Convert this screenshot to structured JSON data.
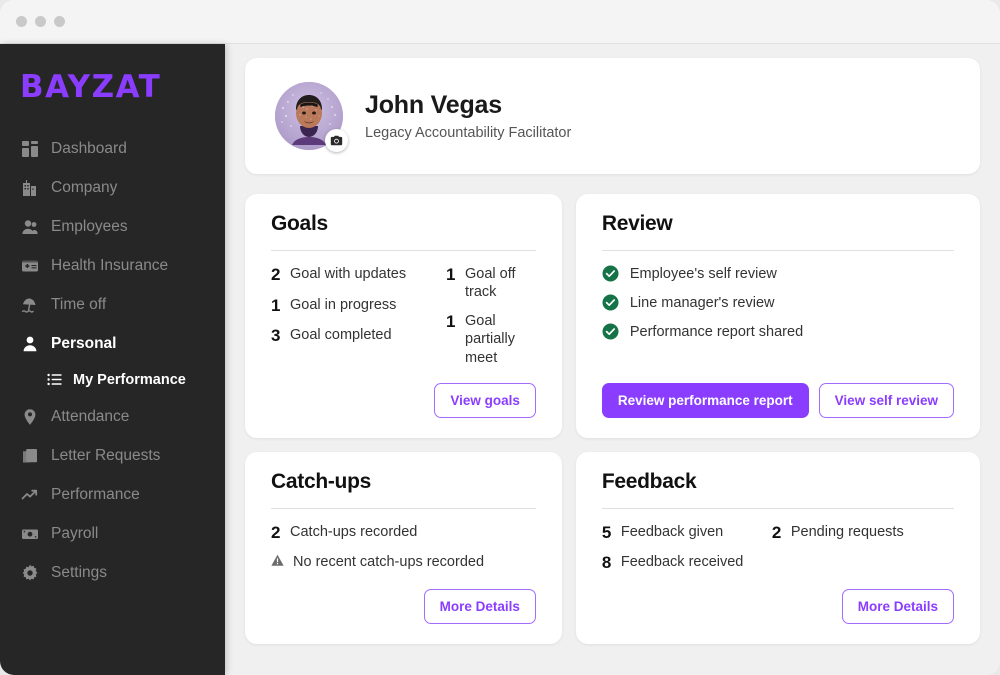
{
  "window": {
    "traffic_dots": 3
  },
  "sidebar": {
    "logo": "BAYZAT",
    "accent_color": "#8b3dff",
    "background_color": "#262626",
    "items": [
      {
        "label": "Dashboard",
        "icon": "dashboard-icon",
        "active": false
      },
      {
        "label": "Company",
        "icon": "building-icon",
        "active": false
      },
      {
        "label": "Employees",
        "icon": "people-icon",
        "active": false
      },
      {
        "label": "Health Insurance",
        "icon": "insurance-card-icon",
        "active": false
      },
      {
        "label": "Time off",
        "icon": "beach-umbrella-icon",
        "active": false
      },
      {
        "label": "Personal",
        "icon": "person-icon",
        "active": true
      },
      {
        "label": "Attendance",
        "icon": "location-pin-icon",
        "active": false
      },
      {
        "label": "Letter Requests",
        "icon": "documents-icon",
        "active": false
      },
      {
        "label": "Performance",
        "icon": "trend-up-icon",
        "active": false
      },
      {
        "label": "Payroll",
        "icon": "money-icon",
        "active": false
      },
      {
        "label": "Settings",
        "icon": "gear-icon",
        "active": false
      }
    ],
    "sub_item": {
      "label": "My Performance",
      "icon": "list-icon",
      "active": true
    }
  },
  "profile": {
    "name": "John Vegas",
    "job_title": "Legacy Accountability Facilitator",
    "avatar_icon": "user-avatar-photo",
    "camera_badge_icon": "camera-icon"
  },
  "goals": {
    "title": "Goals",
    "left_stats": [
      {
        "count": "2",
        "label": "Goal with updates"
      },
      {
        "count": "1",
        "label": "Goal in progress"
      },
      {
        "count": "3",
        "label": "Goal completed"
      }
    ],
    "right_stats": [
      {
        "count": "1",
        "label": "Goal off track"
      },
      {
        "count": "1",
        "label": "Goal partially meet"
      }
    ],
    "button": "View goals"
  },
  "review": {
    "title": "Review",
    "check_color": "#157347",
    "items": [
      {
        "label": "Employee's self review",
        "icon": "check-circle-icon"
      },
      {
        "label": "Line manager's review",
        "icon": "check-circle-icon"
      },
      {
        "label": "Performance report shared",
        "icon": "check-circle-icon"
      }
    ],
    "primary_button": "Review performance report",
    "secondary_button": "View self review"
  },
  "catchups": {
    "title": "Catch-ups",
    "stats": [
      {
        "count": "2",
        "label": "Catch-ups recorded"
      }
    ],
    "warning": {
      "icon": "warning-triangle-icon",
      "label": "No recent catch-ups recorded"
    },
    "button": "More Details"
  },
  "feedback": {
    "title": "Feedback",
    "left_stats": [
      {
        "count": "5",
        "label": "Feedback given"
      },
      {
        "count": "8",
        "label": "Feedback received"
      }
    ],
    "right_stats": [
      {
        "count": "2",
        "label": "Pending requests"
      }
    ],
    "button": "More Details"
  }
}
